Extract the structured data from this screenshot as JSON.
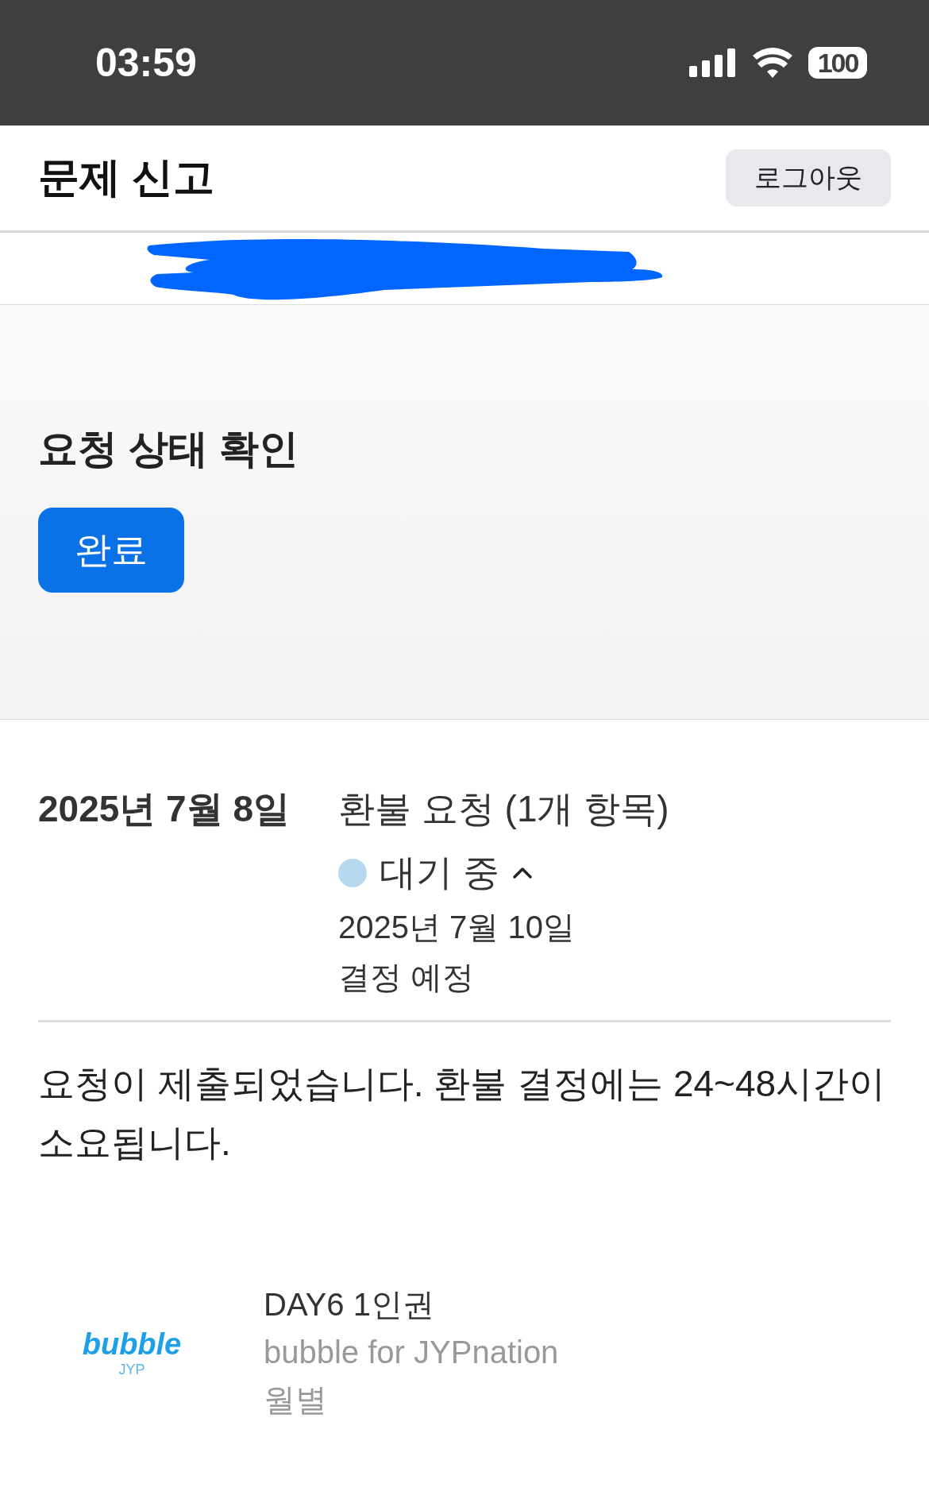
{
  "status_bar": {
    "time": "03:59",
    "battery": "100"
  },
  "header": {
    "title": "문제 신고",
    "logout_button": "로그아웃"
  },
  "request_status": {
    "heading": "요청 상태 확인",
    "done_button": "완료"
  },
  "request": {
    "date": "2025년 7월 8일",
    "title": "환불 요청 (1개 항목)",
    "status": {
      "label": "대기 중",
      "color": "#b8d8f0",
      "expanded": true
    },
    "decision_date": "2025년 7월 10일",
    "decision_label": "결정 예정"
  },
  "message": "요청이 제출되었습니다. 환불 결정에는 24~48시간이 소요됩니다.",
  "item": {
    "logo_word": "bubble",
    "logo_sub": "JYP",
    "name": "DAY6 1인권",
    "app": "bubble for JYPnation",
    "period": "월별"
  }
}
